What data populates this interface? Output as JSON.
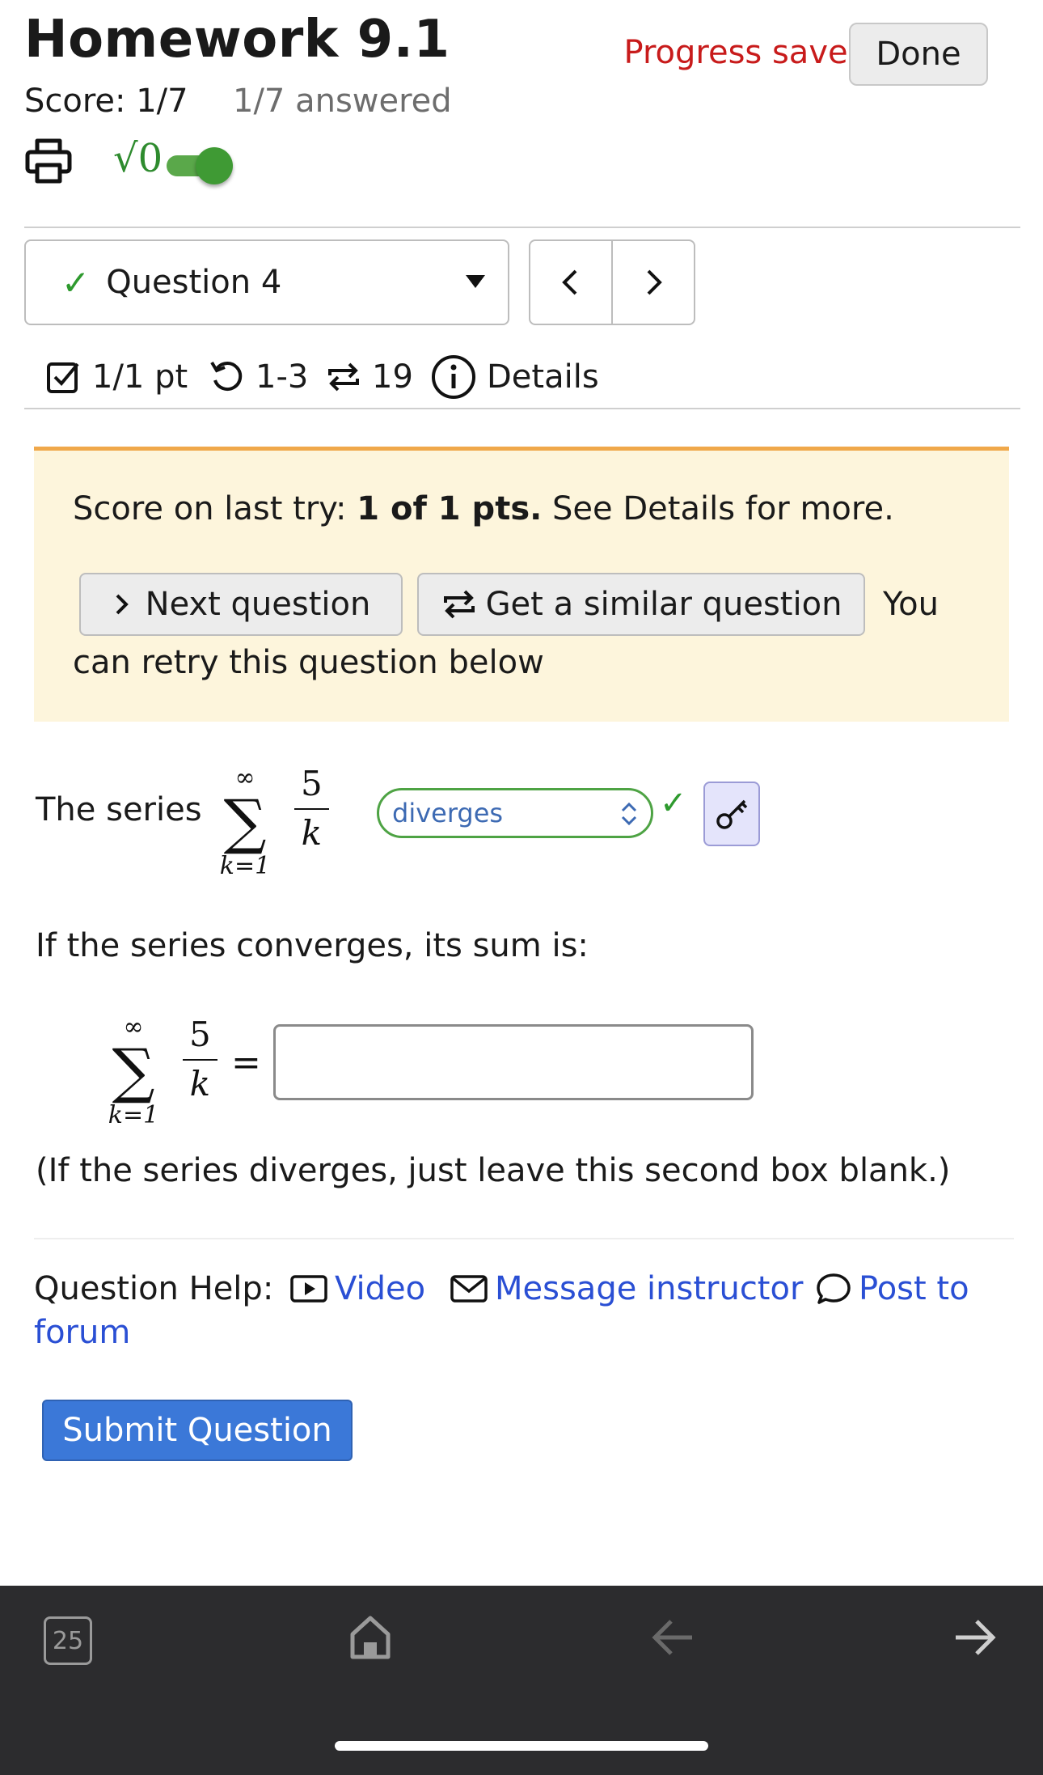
{
  "header": {
    "title": "Homework 9.1",
    "progress_status": "Progress saved",
    "done_label": "Done",
    "score": "Score: 1/7",
    "answered": "1/7 answered"
  },
  "toolbar": {
    "math_toggle_label": "√0",
    "math_toggle_on": true
  },
  "question_nav": {
    "selected_question": "Question 4",
    "prev_label": "<",
    "next_label": ">"
  },
  "question_meta": {
    "points": "1/1 pt",
    "attempts": "1-3",
    "versions": "19",
    "details_label": "Details"
  },
  "notice": {
    "prefix": "Score on last try: ",
    "bold": "1 of 1 pts.",
    "suffix": " See Details for more.",
    "next_button": "Next question",
    "similar_button": "Get a similar question",
    "retry_word": "You",
    "retry_rest": "can retry this question below"
  },
  "question": {
    "series_label": "The series",
    "sum_upper": "∞",
    "sum_lower": "k=1",
    "numerator": "5",
    "denominator": "k",
    "selected_answer": "diverges",
    "converges_prompt": "If the series converges, its sum is:",
    "equals": "=",
    "answer_value": "",
    "diverge_note": "(If the series diverges, just leave this second box blank.)"
  },
  "help": {
    "label": "Question Help:",
    "video": "Video",
    "message": "Message instructor",
    "forum_part1": "Post to",
    "forum_part2": "forum"
  },
  "submit_label": "Submit Question",
  "browser_bar": {
    "tab_count": "25"
  },
  "colors": {
    "accent_green": "#2e9a2e",
    "progress_red": "#c81b1b",
    "link_blue": "#2a4fd4",
    "submit_blue": "#3b78d8",
    "notice_bg": "#fdf5dc"
  }
}
